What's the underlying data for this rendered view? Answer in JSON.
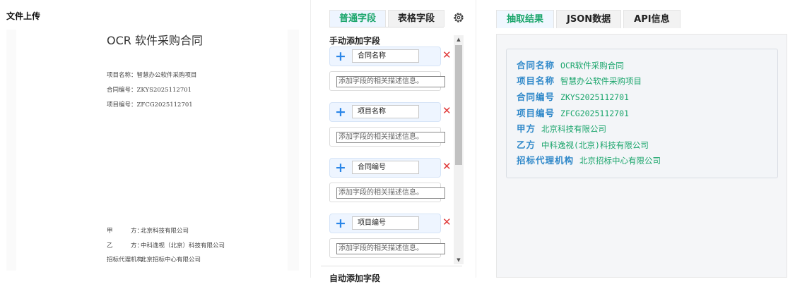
{
  "upload": {
    "title": "文件上传",
    "doc_title": "OCR 软件采购合同",
    "lines": [
      {
        "label": "项目名称：",
        "value": "智慧办公软件采购项目"
      },
      {
        "label": "合同编号：",
        "value": "ZKYS2025112701"
      },
      {
        "label": "项目编号：",
        "value": "ZFCG2025112701"
      }
    ],
    "signatures": [
      {
        "label": "甲　　　方：",
        "value": "北京科技有限公司"
      },
      {
        "label": "乙　　　方：",
        "value": "中科逸视（北京）科技有限公司"
      },
      {
        "label": "招标代理机构：",
        "value": "北京招标中心有限公司"
      }
    ]
  },
  "fields": {
    "tabs": [
      "普通字段",
      "表格字段"
    ],
    "active_tab": 0,
    "settings_icon": "gear-icon",
    "manual_label": "手动添加字段",
    "auto_label": "自动添加字段",
    "items": [
      {
        "name": "合同名称",
        "desc_placeholder": "添加字段的相关描述信息。"
      },
      {
        "name": "项目名称",
        "desc_placeholder": "添加字段的相关描述信息。"
      },
      {
        "name": "合同编号",
        "desc_placeholder": "添加字段的相关描述信息。"
      },
      {
        "name": "项目编号",
        "desc_placeholder": "添加字段的相关描述信息。"
      }
    ],
    "add_symbol": "+",
    "delete_symbol": "✕"
  },
  "results": {
    "tabs": [
      "抽取结果",
      "JSON数据",
      "API信息"
    ],
    "active_tab": 0,
    "rows": [
      {
        "key": "合同名称",
        "value": "OCR软件采购合同"
      },
      {
        "key": "项目名称",
        "value": "智慧办公软件采购项目"
      },
      {
        "key": "合同编号",
        "value": "ZKYS2025112701"
      },
      {
        "key": "项目编号",
        "value": "ZFCG2025112701"
      },
      {
        "key": "甲方",
        "value": "北京科技有限公司"
      },
      {
        "key": "乙方",
        "value": "中科逸视(北京)科技有限公司"
      },
      {
        "key": "招标代理机构",
        "value": "北京招标中心有限公司"
      }
    ]
  },
  "colors": {
    "accent_green": "#1aa56b",
    "key_blue": "#2f88c9",
    "plus_blue": "#2a86e8",
    "delete_red": "#e03a3a"
  }
}
